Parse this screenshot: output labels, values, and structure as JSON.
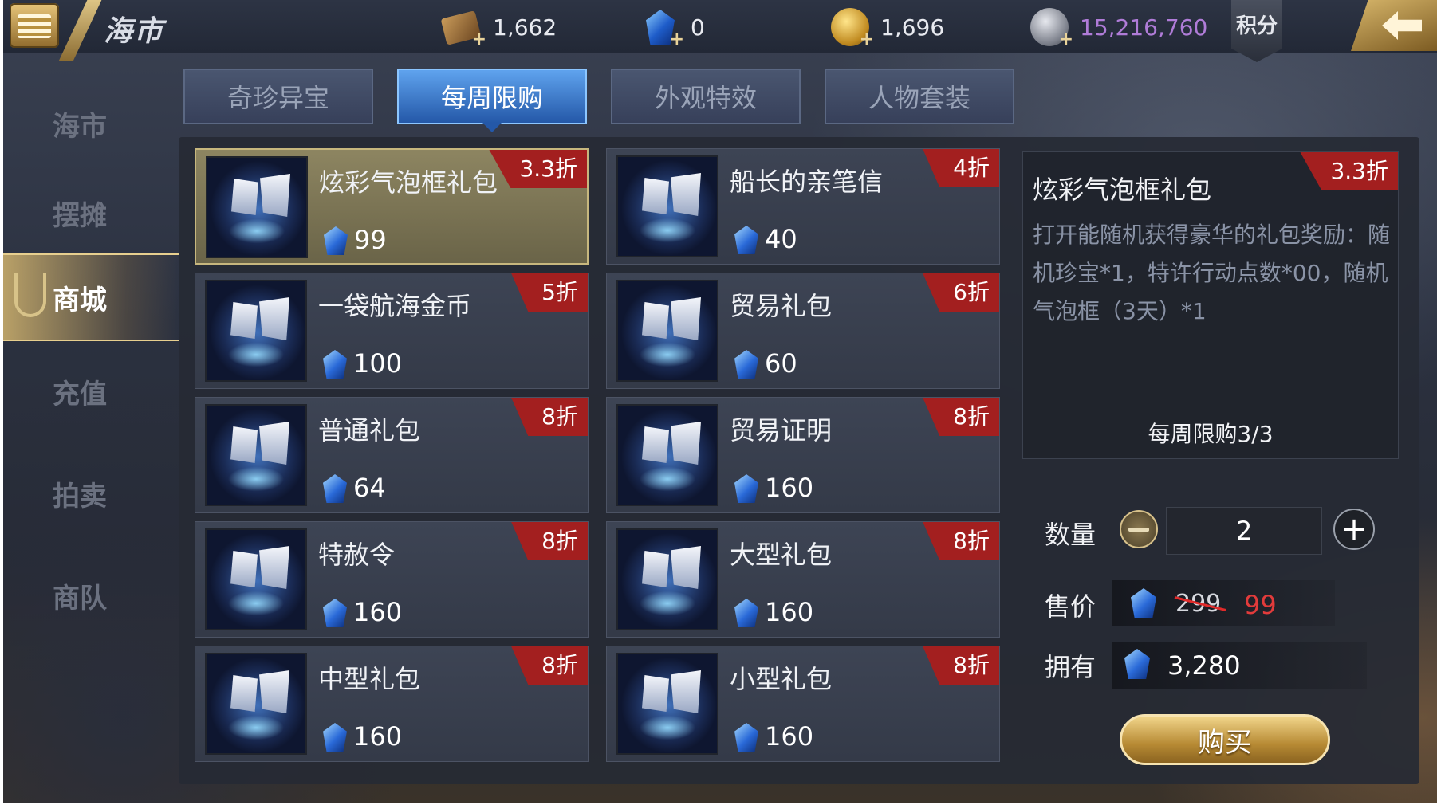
{
  "header": {
    "title": "海市",
    "resources": [
      {
        "icon": "book-icon",
        "value": "1,662"
      },
      {
        "icon": "gem-icon",
        "value": "0"
      },
      {
        "icon": "gold-coin-icon",
        "value": "1,696"
      },
      {
        "icon": "silver-medal-icon",
        "value": "15,216,760"
      }
    ],
    "score_label": "积分"
  },
  "nav": {
    "items": [
      {
        "label": "海市",
        "active": false
      },
      {
        "label": "摆摊",
        "active": false
      },
      {
        "label": "商城",
        "active": true
      },
      {
        "label": "充值",
        "active": false
      },
      {
        "label": "拍卖",
        "active": false
      },
      {
        "label": "商队",
        "active": false
      }
    ]
  },
  "tabs": [
    {
      "label": "奇珍异宝",
      "active": false
    },
    {
      "label": "每周限购",
      "active": true
    },
    {
      "label": "外观特效",
      "active": false
    },
    {
      "label": "人物套装",
      "active": false
    }
  ],
  "items": [
    {
      "name": "炫彩气泡框礼包",
      "price": "99",
      "discount": "3.3折",
      "selected": true
    },
    {
      "name": "船长的亲笔信",
      "price": "40",
      "discount": "4折",
      "selected": false
    },
    {
      "name": "一袋航海金币",
      "price": "100",
      "discount": "5折",
      "selected": false
    },
    {
      "name": "贸易礼包",
      "price": "60",
      "discount": "6折",
      "selected": false
    },
    {
      "name": "普通礼包",
      "price": "64",
      "discount": "8折",
      "selected": false
    },
    {
      "name": "贸易证明",
      "price": "160",
      "discount": "8折",
      "selected": false
    },
    {
      "name": "特赦令",
      "price": "160",
      "discount": "8折",
      "selected": false
    },
    {
      "name": "大型礼包",
      "price": "160",
      "discount": "8折",
      "selected": false
    },
    {
      "name": "中型礼包",
      "price": "160",
      "discount": "8折",
      "selected": false
    },
    {
      "name": "小型礼包",
      "price": "160",
      "discount": "8折",
      "selected": false
    }
  ],
  "detail": {
    "title": "炫彩气泡框礼包",
    "discount": "3.3折",
    "description": "打开能随机获得豪华的礼包奖励：随机珍宝*1，特许行动点数*00，随机气泡框（3天）*1",
    "weekly_limit": "每周限购3/3",
    "quantity_label": "数量",
    "quantity": "2",
    "price_label": "售价",
    "original_price": "299",
    "sale_price": "99",
    "owned_label": "拥有",
    "owned": "3,280",
    "buy_label": "购买"
  },
  "colors": {
    "accent_blue": "#2458a8",
    "discount_red": "#a31f1f",
    "sale_price_red": "#e23b3b",
    "points_purple": "#b07cd8",
    "gold": "#d6b56a"
  }
}
